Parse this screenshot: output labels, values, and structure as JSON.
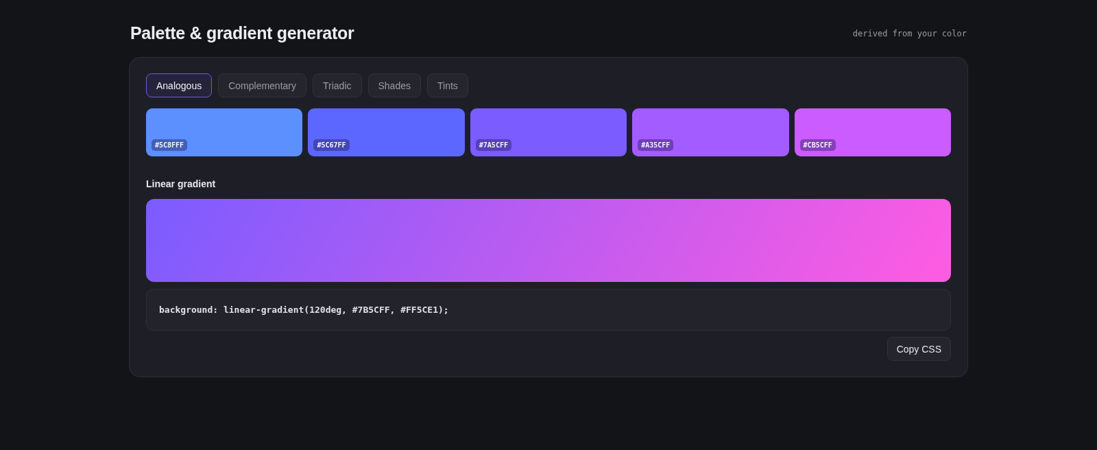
{
  "title": "Palette & gradient generator",
  "subtitle": "derived from your color",
  "tabs": [
    {
      "label": "Analogous",
      "selected": true
    },
    {
      "label": "Complementary",
      "selected": false
    },
    {
      "label": "Triadic",
      "selected": false
    },
    {
      "label": "Shades",
      "selected": false
    },
    {
      "label": "Tints",
      "selected": false
    }
  ],
  "swatches": [
    {
      "hex": "#5C8FFF",
      "color": "#5c8fff"
    },
    {
      "hex": "#5C67FF",
      "color": "#5c67ff"
    },
    {
      "hex": "#7A5CFF",
      "color": "#7a5cff"
    },
    {
      "hex": "#A35CFF",
      "color": "#a35cff"
    },
    {
      "hex": "#CB5CFF",
      "color": "#cb5cff"
    }
  ],
  "gradient": {
    "heading": "Linear gradient",
    "css": "background: linear-gradient(120deg, #7B5CFF, #FF5CE1);"
  },
  "copy_button": "Copy CSS"
}
